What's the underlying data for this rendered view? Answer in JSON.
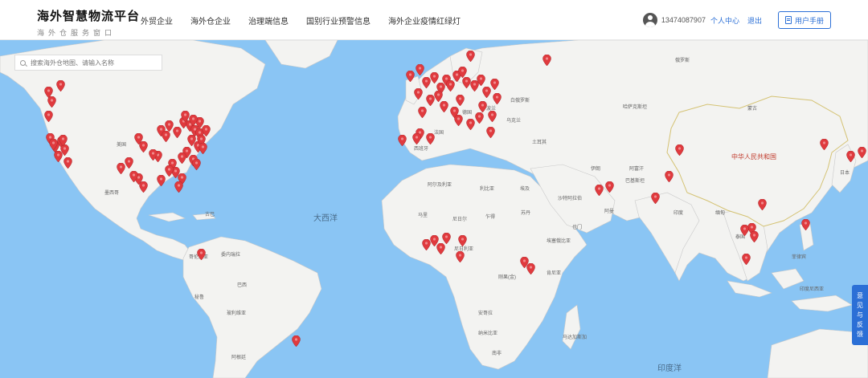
{
  "header": {
    "brand_title": "海外智慧物流平台",
    "brand_sub": "海外仓服务窗口",
    "nav": [
      "外贸企业",
      "海外仓企业",
      "治理端信息",
      "国别行业预警信息",
      "海外企业疫情红绿灯"
    ],
    "phone": "13474087907",
    "profile_label": "个人中心",
    "logout_label": "退出",
    "manual_label": "用户手册",
    "accent_color": "#2b6fd6"
  },
  "search": {
    "placeholder": "搜索海外仓地图、请输入名称"
  },
  "map": {
    "ocean_color": "#8ac5f4",
    "pin_color": "#e03a3e",
    "labels": {
      "atlantic": "大西洋",
      "indian": "印度洋",
      "china": "中华人民共和国",
      "mongolia": "蒙古",
      "kazakhstan": "哈萨克斯坦",
      "russia": "俄罗斯",
      "turkey": "土耳其",
      "iran": "伊朗",
      "saudi": "沙特阿拉伯",
      "egypt": "埃及",
      "algeria": "阿尔及利亚",
      "libya": "利比亚",
      "mali": "马里",
      "niger": "尼日尔",
      "chad": "乍得",
      "sudan": "苏丹",
      "nigeria": "尼日利亚",
      "ethiopia": "埃塞俄比亚",
      "kenya": "肯尼亚",
      "drc": "刚果(金)",
      "angola": "安哥拉",
      "namibia": "纳米比亚",
      "southafrica": "南非",
      "madagascar": "马达加斯加",
      "india": "印度",
      "myanmar": "缅甸",
      "thailand": "泰国",
      "indonesia": "印度尼西亚",
      "usa": "美国",
      "mexico": "墨西哥",
      "colombia": "哥伦比亚",
      "venezuela": "委内瑞拉",
      "brazil": "巴西",
      "peru": "秘鲁",
      "bolivia": "玻利维亚",
      "argentina": "阿根廷",
      "france": "法国",
      "spain": "西班牙",
      "germany": "德国",
      "poland": "波兰",
      "ukraine": "乌克兰",
      "belarus": "白俄罗斯",
      "pakistan": "巴基斯坦",
      "afghanistan": "阿富汗",
      "yemen": "也门",
      "oman": "阿曼",
      "cuba": "古巴",
      "japan": "日本",
      "philippines": "菲律宾"
    }
  },
  "feedback_label": [
    "意",
    "见",
    "与",
    "反",
    "馈"
  ]
}
